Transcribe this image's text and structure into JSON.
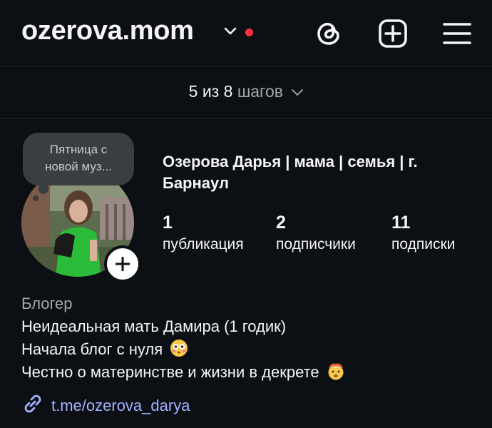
{
  "header": {
    "username": "ozerova.mom",
    "notification_dot_color": "#ff3040",
    "icons": [
      "chevron-down-icon",
      "threads-icon",
      "add-post-icon",
      "menu-icon"
    ]
  },
  "steps": {
    "current": "5 из 8",
    "word": "шагов"
  },
  "note": {
    "text_line1": "Пятница с",
    "text_line2": "новой муз..."
  },
  "profile": {
    "full_name": "Озерова Дарья | мама | семья | г. Барнаул",
    "stats": [
      {
        "value": "1",
        "label": "публикация"
      },
      {
        "value": "2",
        "label": "подписчики"
      },
      {
        "value": "11",
        "label": "подписки"
      }
    ]
  },
  "bio": {
    "category": "Блогер",
    "line1": "Неидеальная мать Дамира (1 годик)",
    "line2": "Начала блог с нуля",
    "line2_emoji": "flushed-face-emoji",
    "line3": "Честно о материнстве и жизни в декрете",
    "line3_emoji": "exploding-head-emoji"
  },
  "link": {
    "text": "t.me/ozerova_darya",
    "color": "#a3b3ff"
  }
}
